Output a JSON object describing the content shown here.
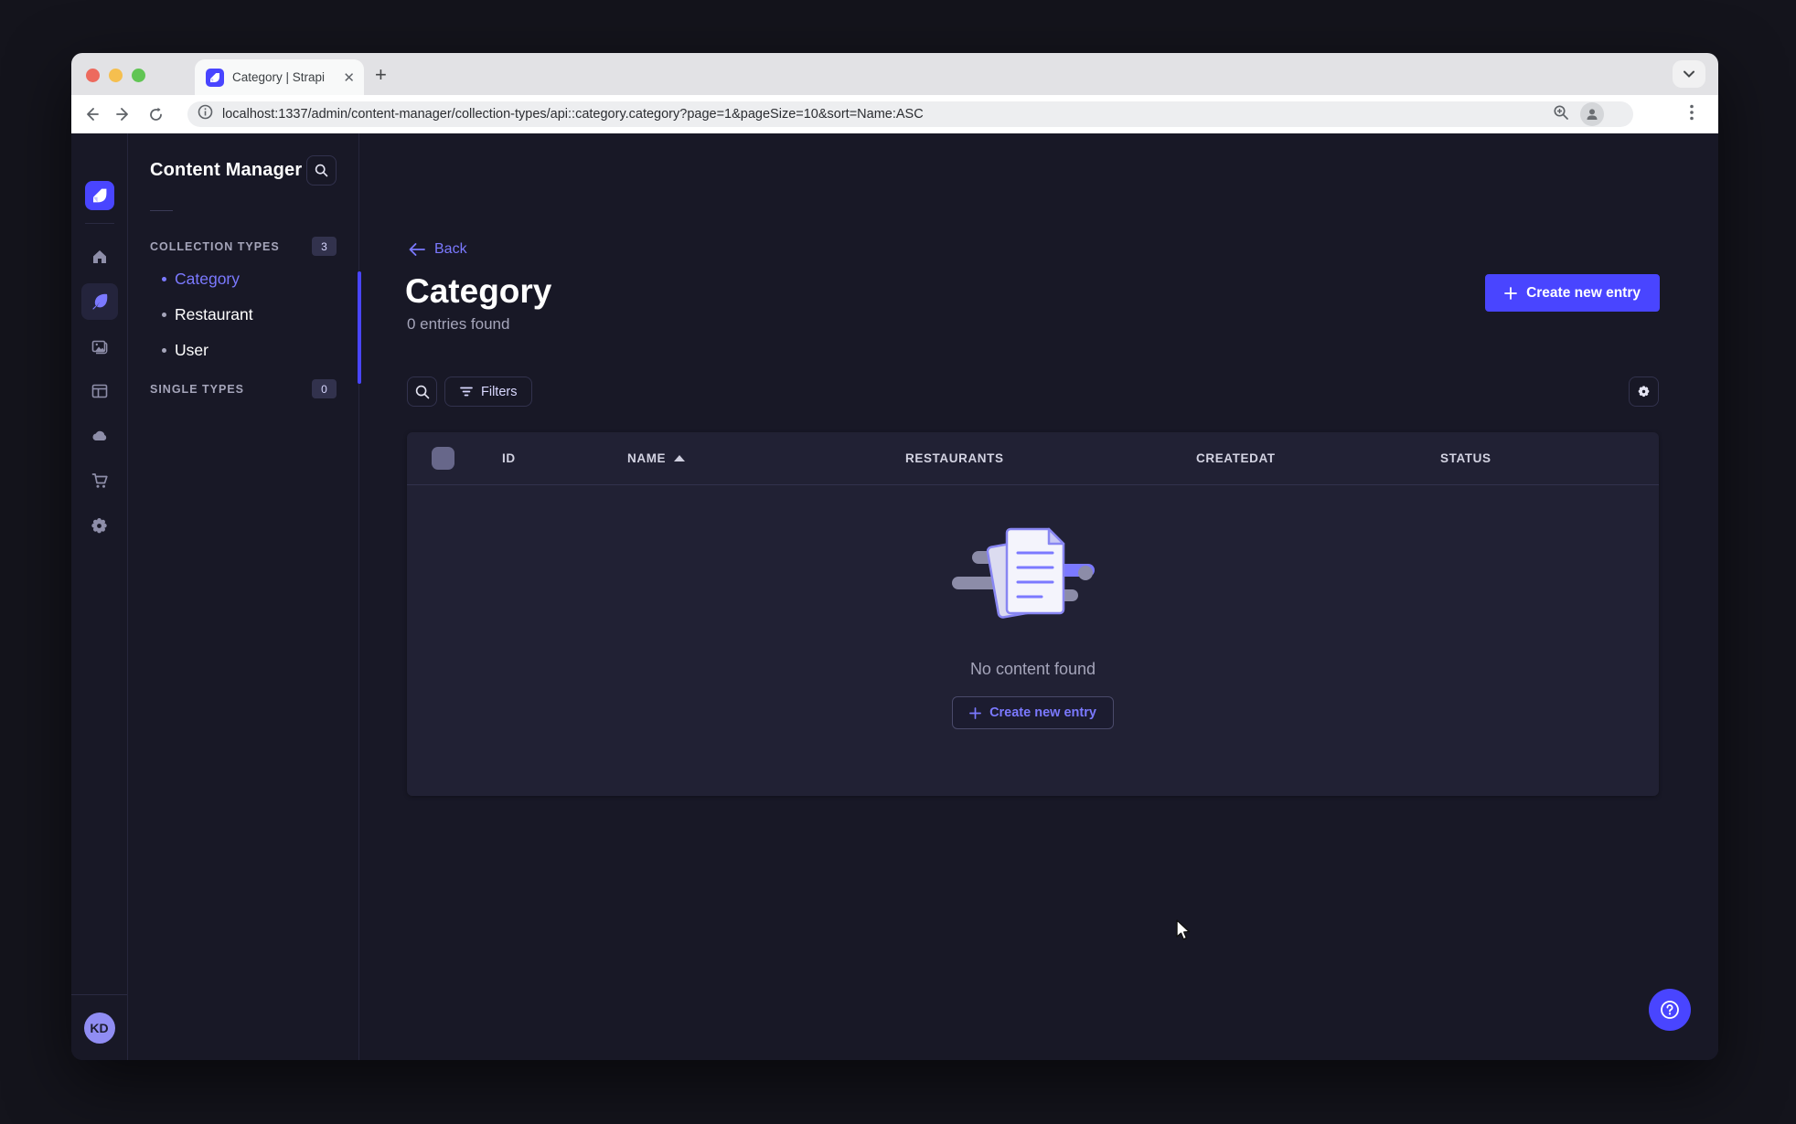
{
  "browser": {
    "tab_title": "Category | Strapi",
    "new_tab_label": "+",
    "url": "localhost:1337/admin/content-manager/collection-types/api::category.category?page=1&pageSize=10&sort=Name:ASC"
  },
  "sidebar": {
    "avatar_initials": "KD"
  },
  "subnav": {
    "title": "Content Manager",
    "sections": [
      {
        "label": "COLLECTION TYPES",
        "count": "3",
        "items": [
          {
            "label": "Category",
            "active": true
          },
          {
            "label": "Restaurant",
            "active": false
          },
          {
            "label": "User",
            "active": false
          }
        ]
      },
      {
        "label": "SINGLE TYPES",
        "count": "0",
        "items": []
      }
    ]
  },
  "main": {
    "back_label": "Back",
    "title": "Category",
    "subtitle": "0 entries found",
    "create_button_label": "Create new entry",
    "filters_button_label": "Filters",
    "table": {
      "columns": [
        "ID",
        "NAME",
        "RESTAURANTS",
        "CREATEDAT",
        "STATUS"
      ],
      "sorted_column": "NAME",
      "sort_direction": "ASC",
      "rows": []
    },
    "empty_state": {
      "message": "No content found",
      "cta_label": "Create new entry"
    }
  },
  "colors": {
    "primary": "#4945ff",
    "primary_light": "#7b79ff",
    "app_background": "#181826",
    "card_background": "#212134",
    "border": "#32324d",
    "text_muted": "#a5a5ba",
    "traffic_red": "#ed6a5e",
    "traffic_yellow": "#f5bf4f",
    "traffic_green": "#61c554"
  }
}
